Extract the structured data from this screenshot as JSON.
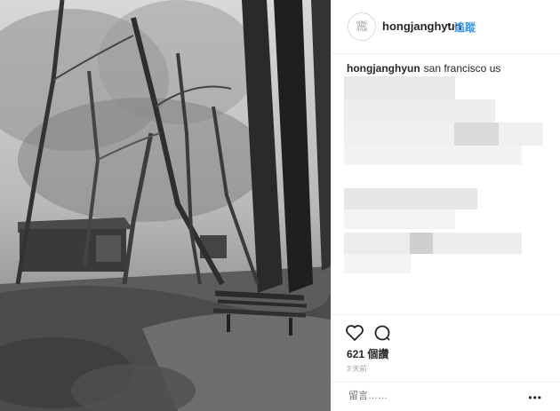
{
  "post": {
    "username": "hongjanghyun",
    "separator": "•",
    "follow_label": "追蹤",
    "avatar_text": "HONG JANG HYUN",
    "caption_user": "hongjanghyun",
    "caption_text": "san francisco us",
    "likes": "621 個讚",
    "time": "3 天前",
    "comment_placeholder": "留言……",
    "more": "•••"
  },
  "photo": {
    "description_icon": "forest-bench-photo"
  },
  "colors": {
    "link": "#3897f0",
    "text": "#262626",
    "muted": "#999999",
    "divider": "#efefef"
  }
}
